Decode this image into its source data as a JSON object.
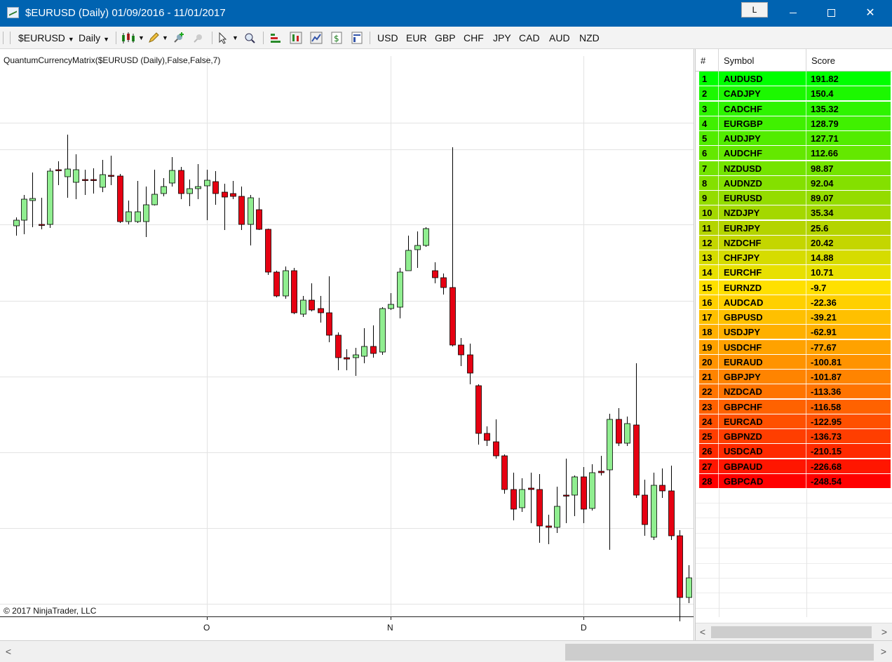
{
  "window": {
    "title": "$EURUSD (Daily)  01/09/2016 - 11/01/2017",
    "link_label": "L",
    "close_glyph": "✕"
  },
  "toolbar": {
    "instrument": "$EURUSD",
    "period": "Daily",
    "currencies": [
      "USD",
      "EUR",
      "GBP",
      "CHF",
      "JPY",
      "CAD",
      "AUD",
      "NZD"
    ]
  },
  "chart": {
    "indicator_label": "QuantumCurrencyMatrix($EURUSD (Daily),False,False,7)",
    "copyright": "© 2017 NinjaTrader, LLC",
    "x_ticks": [
      "O",
      "N",
      "D"
    ],
    "colors": {
      "up": "#90ee90",
      "down": "#e60012",
      "grid": "#e3e3e3"
    }
  },
  "matrix": {
    "headers": {
      "rank": "#",
      "symbol": "Symbol",
      "score": "Score"
    },
    "rows": [
      {
        "rank": "1",
        "symbol": "AUDUSD",
        "score": "191.82",
        "color": "#00ff00"
      },
      {
        "rank": "2",
        "symbol": "CADJPY",
        "score": "150.4",
        "color": "#1cf800"
      },
      {
        "rank": "3",
        "symbol": "CADCHF",
        "score": "135.32",
        "color": "#2ef400"
      },
      {
        "rank": "4",
        "symbol": "EURGBP",
        "score": "128.79",
        "color": "#40f000"
      },
      {
        "rank": "5",
        "symbol": "AUDJPY",
        "score": "127.71",
        "color": "#52ec00"
      },
      {
        "rank": "6",
        "symbol": "AUDCHF",
        "score": "112.66",
        "color": "#64e800"
      },
      {
        "rank": "7",
        "symbol": "NZDUSD",
        "score": "98.87",
        "color": "#74e400"
      },
      {
        "rank": "8",
        "symbol": "AUDNZD",
        "score": "92.04",
        "color": "#84e000"
      },
      {
        "rank": "9",
        "symbol": "EURUSD",
        "score": "89.07",
        "color": "#94dc00"
      },
      {
        "rank": "10",
        "symbol": "NZDJPY",
        "score": "35.34",
        "color": "#a4d800"
      },
      {
        "rank": "11",
        "symbol": "EURJPY",
        "score": "25.6",
        "color": "#b4d400"
      },
      {
        "rank": "12",
        "symbol": "NZDCHF",
        "score": "20.42",
        "color": "#c4d600"
      },
      {
        "rank": "13",
        "symbol": "CHFJPY",
        "score": "14.88",
        "color": "#d6dc00"
      },
      {
        "rank": "14",
        "symbol": "EURCHF",
        "score": "10.71",
        "color": "#e8e000"
      },
      {
        "rank": "15",
        "symbol": "EURNZD",
        "score": "-9.7",
        "color": "#ffe000"
      },
      {
        "rank": "16",
        "symbol": "AUDCAD",
        "score": "-22.36",
        "color": "#ffd000"
      },
      {
        "rank": "17",
        "symbol": "GBPUSD",
        "score": "-39.21",
        "color": "#ffc000"
      },
      {
        "rank": "18",
        "symbol": "USDJPY",
        "score": "-62.91",
        "color": "#ffb000"
      },
      {
        "rank": "19",
        "symbol": "USDCHF",
        "score": "-77.67",
        "color": "#ffa200"
      },
      {
        "rank": "20",
        "symbol": "EURAUD",
        "score": "-100.81",
        "color": "#ff9300"
      },
      {
        "rank": "21",
        "symbol": "GBPJPY",
        "score": "-101.87",
        "color": "#ff8400"
      },
      {
        "rank": "22",
        "symbol": "NZDCAD",
        "score": "-113.36",
        "color": "#ff7400"
      },
      {
        "rank": "23",
        "symbol": "GBPCHF",
        "score": "-116.58",
        "color": "#ff6200"
      },
      {
        "rank": "24",
        "symbol": "EURCAD",
        "score": "-122.95",
        "color": "#ff5000"
      },
      {
        "rank": "25",
        "symbol": "GBPNZD",
        "score": "-136.73",
        "color": "#ff3e00"
      },
      {
        "rank": "26",
        "symbol": "USDCAD",
        "score": "-210.15",
        "color": "#ff2a00"
      },
      {
        "rank": "27",
        "symbol": "GBPAUD",
        "score": "-226.68",
        "color": "#ff1600"
      },
      {
        "rank": "28",
        "symbol": "GBPCAD",
        "score": "-248.54",
        "color": "#ff0000"
      }
    ]
  },
  "scroll": {
    "left_arrow": "<",
    "right_arrow": ">"
  },
  "chart_data": {
    "type": "candlestick",
    "instrument": "$EURUSD",
    "period": "Daily",
    "x_ticks": [
      "O",
      "N",
      "D"
    ],
    "candles": [
      [
        23,
        252,
        258,
        244,
        240,
        266
      ],
      [
        34,
        244,
        244,
        214,
        208,
        264
      ],
      [
        46,
        216,
        248,
        213,
        176,
        254
      ],
      [
        59,
        250,
        242,
        250,
        212,
        257
      ],
      [
        71,
        250,
        250,
        174,
        170,
        255
      ],
      [
        83,
        172,
        182,
        172,
        160,
        194
      ],
      [
        96,
        182,
        182,
        171,
        122,
        212
      ],
      [
        108,
        190,
        190,
        172,
        150,
        214
      ],
      [
        121,
        186,
        186,
        186,
        172,
        208
      ],
      [
        133,
        186,
        196,
        186,
        170,
        206
      ],
      [
        146,
        197,
        197,
        179,
        158,
        204
      ],
      [
        158,
        180,
        180,
        181,
        152,
        194
      ],
      [
        171,
        181,
        181,
        246,
        178,
        248
      ],
      [
        183,
        246,
        246,
        232,
        216,
        250
      ],
      [
        196,
        246,
        246,
        232,
        188,
        248
      ],
      [
        208,
        246,
        246,
        222,
        196,
        268
      ],
      [
        220,
        222,
        222,
        207,
        172,
        223
      ],
      [
        233,
        206,
        206,
        196,
        184,
        210
      ],
      [
        245,
        191,
        191,
        173,
        154,
        196
      ],
      [
        258,
        173,
        173,
        206,
        168,
        214
      ],
      [
        270,
        206,
        206,
        199,
        186,
        224
      ],
      [
        282,
        199,
        199,
        196,
        164,
        214
      ],
      [
        295,
        195,
        195,
        187,
        172,
        244
      ],
      [
        307,
        189,
        189,
        206,
        174,
        222
      ],
      [
        320,
        204,
        204,
        211,
        192,
        258
      ],
      [
        332,
        206,
        206,
        210,
        188,
        214
      ],
      [
        344,
        210,
        210,
        250,
        196,
        258
      ],
      [
        357,
        250,
        250,
        212,
        208,
        280
      ],
      [
        369,
        229,
        229,
        257,
        212,
        258
      ],
      [
        382,
        257,
        257,
        318,
        256,
        322
      ],
      [
        394,
        318,
        318,
        352,
        316,
        354
      ],
      [
        407,
        352,
        352,
        316,
        310,
        356
      ],
      [
        419,
        316,
        316,
        376,
        312,
        378
      ],
      [
        432,
        378,
        378,
        358,
        352,
        382
      ],
      [
        444,
        358,
        358,
        372,
        334,
        374
      ],
      [
        457,
        370,
        370,
        376,
        352,
        390
      ],
      [
        469,
        376,
        376,
        408,
        324,
        418
      ],
      [
        482,
        408,
        408,
        440,
        404,
        458
      ],
      [
        494,
        440,
        440,
        442,
        428,
        458
      ],
      [
        507,
        440,
        440,
        436,
        426,
        466
      ],
      [
        519,
        438,
        438,
        424,
        398,
        448
      ],
      [
        532,
        424,
        424,
        434,
        394,
        440
      ],
      [
        545,
        432,
        432,
        370,
        368,
        436
      ],
      [
        557,
        370,
        370,
        364,
        348,
        372
      ],
      [
        570,
        368,
        368,
        318,
        312,
        384
      ],
      [
        582,
        316,
        316,
        287,
        266,
        316
      ],
      [
        595,
        286,
        286,
        280,
        260,
        312
      ],
      [
        607,
        280,
        280,
        256,
        254,
        282
      ],
      [
        620,
        316,
        316,
        326,
        304,
        334
      ],
      [
        632,
        326,
        326,
        340,
        320,
        350
      ],
      [
        645,
        340,
        340,
        422,
        140,
        424
      ],
      [
        657,
        422,
        422,
        436,
        412,
        452
      ],
      [
        670,
        436,
        436,
        462,
        420,
        478
      ],
      [
        682,
        480,
        480,
        548,
        478,
        564
      ],
      [
        694,
        548,
        548,
        558,
        538,
        566
      ],
      [
        707,
        560,
        560,
        580,
        528,
        584
      ],
      [
        719,
        580,
        580,
        628,
        578,
        634
      ],
      [
        732,
        628,
        628,
        656,
        604,
        672
      ],
      [
        744,
        654,
        654,
        628,
        612,
        660
      ],
      [
        757,
        626,
        626,
        628,
        604,
        676
      ],
      [
        769,
        628,
        628,
        680,
        606,
        704
      ],
      [
        782,
        680,
        680,
        682,
        664,
        706
      ],
      [
        794,
        682,
        682,
        652,
        624,
        690
      ],
      [
        807,
        636,
        636,
        637,
        584,
        676
      ],
      [
        819,
        636,
        636,
        610,
        608,
        666
      ],
      [
        832,
        610,
        610,
        656,
        596,
        676
      ],
      [
        844,
        655,
        655,
        604,
        592,
        658
      ],
      [
        857,
        602,
        602,
        604,
        580,
        608
      ],
      [
        869,
        600,
        600,
        528,
        520,
        714
      ],
      [
        882,
        528,
        528,
        562,
        512,
        566
      ],
      [
        894,
        562,
        562,
        534,
        524,
        566
      ],
      [
        907,
        536,
        536,
        636,
        448,
        640
      ],
      [
        919,
        636,
        636,
        678,
        614,
        694
      ],
      [
        932,
        696,
        696,
        622,
        604,
        700
      ],
      [
        944,
        622,
        622,
        630,
        598,
        640
      ],
      [
        957,
        630,
        630,
        694,
        594,
        700
      ],
      [
        969,
        694,
        694,
        782,
        686,
        816
      ],
      [
        982,
        782,
        782,
        754,
        736,
        790
      ]
    ]
  }
}
